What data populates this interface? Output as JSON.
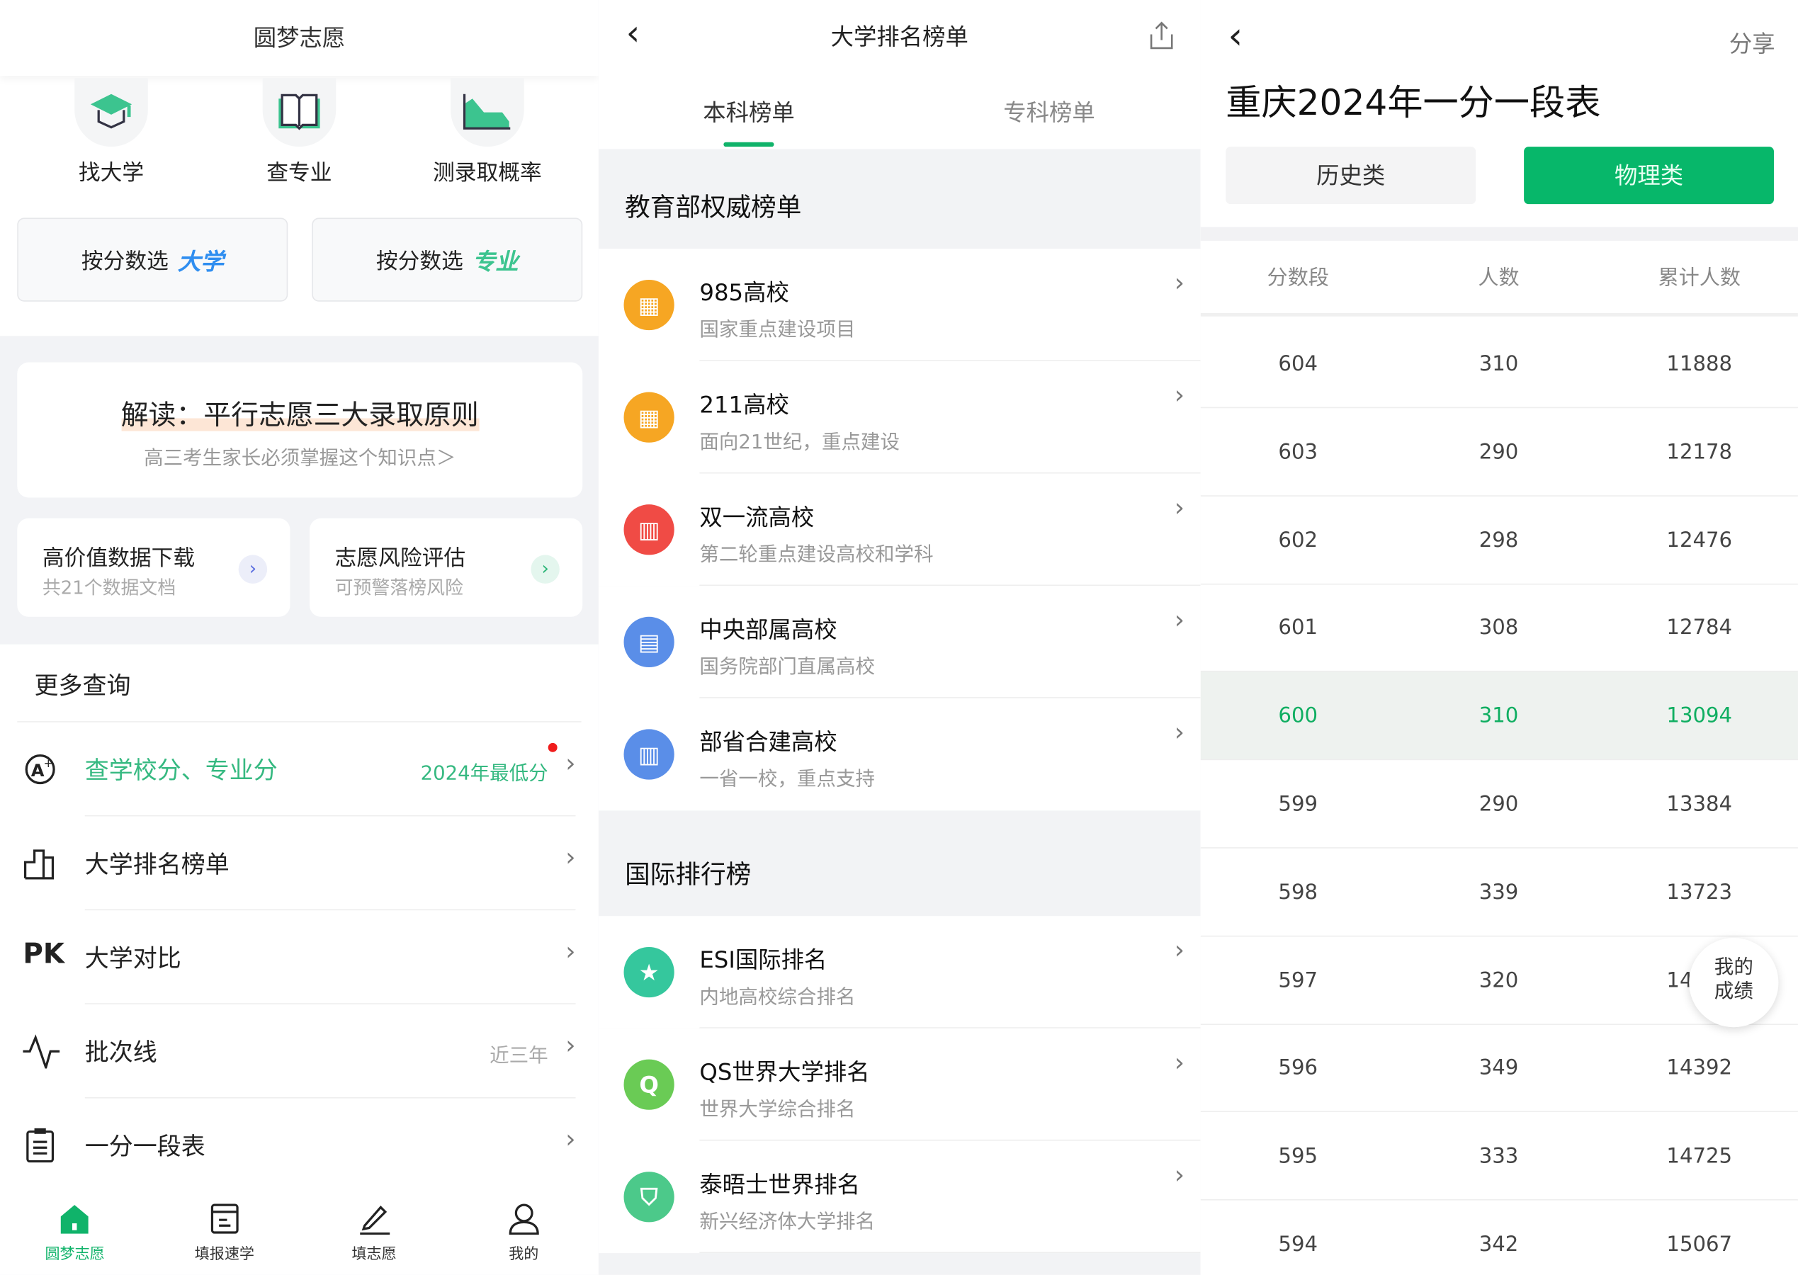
{
  "colors": {
    "accent": "#07b76a",
    "highlight_row": "#eef2ef"
  },
  "home": {
    "title": "圆梦志愿",
    "quick": [
      {
        "label": "找大学",
        "icon": "graduation-cap-icon"
      },
      {
        "label": "查专业",
        "icon": "book-icon"
      },
      {
        "label": "测录取概率",
        "icon": "area-chart-icon"
      }
    ],
    "score_select": [
      {
        "prefix": "按分数选",
        "emph": "大学"
      },
      {
        "prefix": "按分数选",
        "emph": "专业"
      }
    ],
    "banner": {
      "title": "解读：平行志愿三大录取原则",
      "subtitle": "高三考生家长必须掌握这个知识点＞"
    },
    "cards": [
      {
        "title": "高价值数据下载",
        "sub": "共21个数据文档"
      },
      {
        "title": "志愿风险评估",
        "sub": "可预警落榜风险"
      }
    ],
    "more_title": "更多查询",
    "menu": [
      {
        "label": "查学校分、专业分",
        "right": "2024年最低分",
        "icon": "a-plus-icon"
      },
      {
        "label": "大学排名榜单",
        "right": "",
        "icon": "bar-chart-icon"
      },
      {
        "label": "大学对比",
        "right": "",
        "icon": "pk-icon",
        "icon_text": "PK"
      },
      {
        "label": "批次线",
        "right": "近三年",
        "icon": "pulse-line-icon"
      },
      {
        "label": "一分一段表",
        "right": "",
        "icon": "clipboard-icon"
      }
    ],
    "tabs": [
      {
        "label": "圆梦志愿",
        "active": true
      },
      {
        "label": "填报速学"
      },
      {
        "label": "填志愿"
      },
      {
        "label": "我的"
      }
    ]
  },
  "ranking": {
    "title": "大学排名榜单",
    "tabs": [
      {
        "label": "本科榜单",
        "active": true
      },
      {
        "label": "专科榜单"
      }
    ],
    "sections": [
      {
        "title": "教育部权威榜单",
        "items": [
          {
            "title": "985高校",
            "sub": "国家重点建设项目",
            "color": "#f6a623"
          },
          {
            "title": "211高校",
            "sub": "面向21世纪，重点建设",
            "color": "#f6a623"
          },
          {
            "title": "双一流高校",
            "sub": "第二轮重点建设高校和学科",
            "color": "#f04b45"
          },
          {
            "title": "中央部属高校",
            "sub": "国务院部门直属高校",
            "color": "#5a8ee8"
          },
          {
            "title": "部省合建高校",
            "sub": "一省一校，重点支持",
            "color": "#5a8ee8"
          }
        ]
      },
      {
        "title": "国际排行榜",
        "items": [
          {
            "title": "ESI国际排名",
            "sub": "内地高校综合排名",
            "color": "#35c79d"
          },
          {
            "title": "QS世界大学排名",
            "sub": "世界大学综合排名",
            "color": "#6acb55",
            "letter": "Q"
          },
          {
            "title": "泰晤士世界排名",
            "sub": "新兴经济体大学排名",
            "color": "#4cc98a"
          }
        ]
      }
    ]
  },
  "table": {
    "share": "分享",
    "title": "重庆2024年一分一段表",
    "segments": [
      {
        "label": "历史类"
      },
      {
        "label": "物理类",
        "active": true
      }
    ],
    "headers": [
      "分数段",
      "人数",
      "累计人数"
    ],
    "rows": [
      [
        "604",
        "310",
        "11888"
      ],
      [
        "603",
        "290",
        "12178"
      ],
      [
        "602",
        "298",
        "12476"
      ],
      [
        "601",
        "308",
        "12784"
      ],
      [
        "600",
        "310",
        "13094"
      ],
      [
        "599",
        "290",
        "13384"
      ],
      [
        "598",
        "339",
        "13723"
      ],
      [
        "597",
        "320",
        "14043"
      ],
      [
        "596",
        "349",
        "14392"
      ],
      [
        "595",
        "333",
        "14725"
      ],
      [
        "594",
        "342",
        "15067"
      ]
    ],
    "highlight_score": "600",
    "float_button": "我的成绩"
  }
}
